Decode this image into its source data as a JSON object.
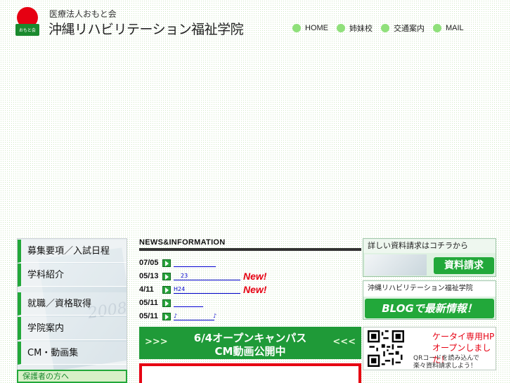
{
  "header": {
    "logo_text": "おもと会",
    "org_name": "医療法人おもと会",
    "school_name": "沖縄リハビリテーション福祉学院"
  },
  "topnav": [
    {
      "label": "HOME"
    },
    {
      "label": "姉妹校"
    },
    {
      "label": "交通案内"
    },
    {
      "label": "MAIL"
    }
  ],
  "sidemenu": {
    "items": [
      {
        "label": "募集要項／入試日程"
      },
      {
        "label": "学科紹介"
      },
      {
        "label": "就職／資格取得"
      },
      {
        "label": "学院案内"
      },
      {
        "label": "CM・動画集"
      }
    ],
    "year_watermark": "2008",
    "banner_label": "保護者の方へ"
  },
  "news": {
    "title": "NEWS&INFORMATION",
    "items": [
      {
        "date": "07/05",
        "link": "",
        "new": ""
      },
      {
        "date": "05/13",
        "link": "23",
        "new": "New!"
      },
      {
        "date": "4/11",
        "link": "H24",
        "new": "New!"
      },
      {
        "date": "05/11",
        "link": "",
        "new": ""
      },
      {
        "date": "05/11",
        "link": "♪                    ♪",
        "new": ""
      }
    ]
  },
  "cm_banner": {
    "line1": "6/4オープンキャンパス",
    "line2": "CM動画公開中",
    "chevron_left": ">>>",
    "chevron_right": "<<<"
  },
  "right": {
    "request_text": "詳しい資料請求はコチラから",
    "request_button": "資料請求",
    "blog_text": "沖縄リハビリテーション福祉学院",
    "blog_button": "BLOGで最新情報！",
    "mobile_line1": "ケータイ専用HP",
    "mobile_line2": "オープンしました！",
    "mobile_line3": "QRコードを読み込んで",
    "mobile_line4": "楽々資料請求しよう！"
  },
  "colors": {
    "brand_green": "#22a83a",
    "accent_red": "#e60012",
    "link_blue": "#0000cc"
  }
}
